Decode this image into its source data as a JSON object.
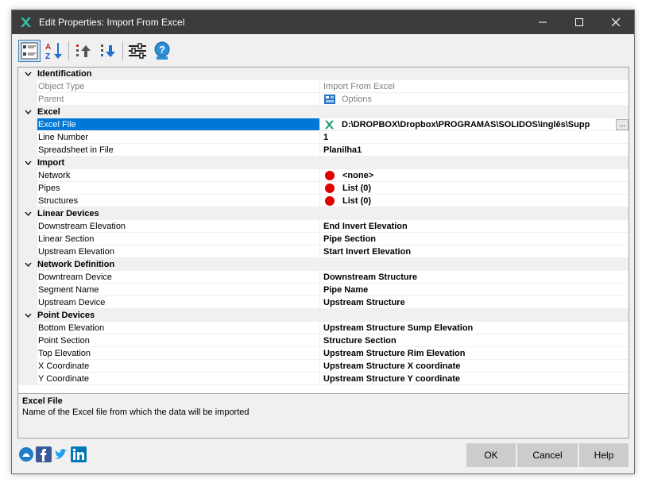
{
  "window": {
    "title": "Edit Properties: Import From Excel"
  },
  "categories": [
    {
      "label": "Identification",
      "rows": [
        {
          "name": "Object Type",
          "value": "Import From Excel",
          "readonly": true,
          "icon": ""
        },
        {
          "name": "Parent",
          "value": "Options",
          "readonly": true,
          "icon": "options-icon"
        }
      ]
    },
    {
      "label": "Excel",
      "rows": [
        {
          "name": "Excel File",
          "value": "D:\\DROPBOX\\Dropbox\\PROGRAMAS\\SOLIDOS\\inglês\\Supp",
          "selected": true,
          "icon": "excel-icon",
          "ellipsis": "..."
        },
        {
          "name": "Line Number",
          "value": "1"
        },
        {
          "name": "Spreadsheet in File",
          "value": "Planilha1"
        }
      ]
    },
    {
      "label": "Import",
      "rows": [
        {
          "name": "Network",
          "value": "<none>",
          "icon": "red-dot-icon"
        },
        {
          "name": "Pipes",
          "value": "List (0)",
          "icon": "red-dot-icon"
        },
        {
          "name": "Structures",
          "value": "List (0)",
          "icon": "red-dot-icon"
        }
      ]
    },
    {
      "label": "Linear Devices",
      "rows": [
        {
          "name": "Downstream Elevation",
          "value": "End Invert Elevation"
        },
        {
          "name": "Linear Section",
          "value": "Pipe Section"
        },
        {
          "name": "Upstream Elevation",
          "value": "Start Invert Elevation"
        }
      ]
    },
    {
      "label": "Network Definition",
      "rows": [
        {
          "name": "Downtream Device",
          "value": "Downstream Structure"
        },
        {
          "name": "Segment Name",
          "value": "Pipe Name"
        },
        {
          "name": "Upstream Device",
          "value": "Upstream Structure"
        }
      ]
    },
    {
      "label": "Point Devices",
      "rows": [
        {
          "name": "Bottom Elevation",
          "value": "Upstream Structure Sump Elevation"
        },
        {
          "name": "Point Section",
          "value": "Structure Section"
        },
        {
          "name": "Top Elevation",
          "value": "Upstream Structure Rim Elevation"
        },
        {
          "name": "X Coordinate",
          "value": "Upstream Structure X coordinate"
        },
        {
          "name": "Y Coordinate",
          "value": "Upstream Structure Y coordinate"
        }
      ]
    }
  ],
  "description": {
    "title": "Excel File",
    "text": "Name of the Excel file from which the data will be imported"
  },
  "buttons": {
    "ok": "OK",
    "cancel": "Cancel",
    "help": "Help"
  },
  "colors": {
    "selection": "#0078d7",
    "titlebar": "#3c3c3c",
    "status_red": "#e30000"
  }
}
